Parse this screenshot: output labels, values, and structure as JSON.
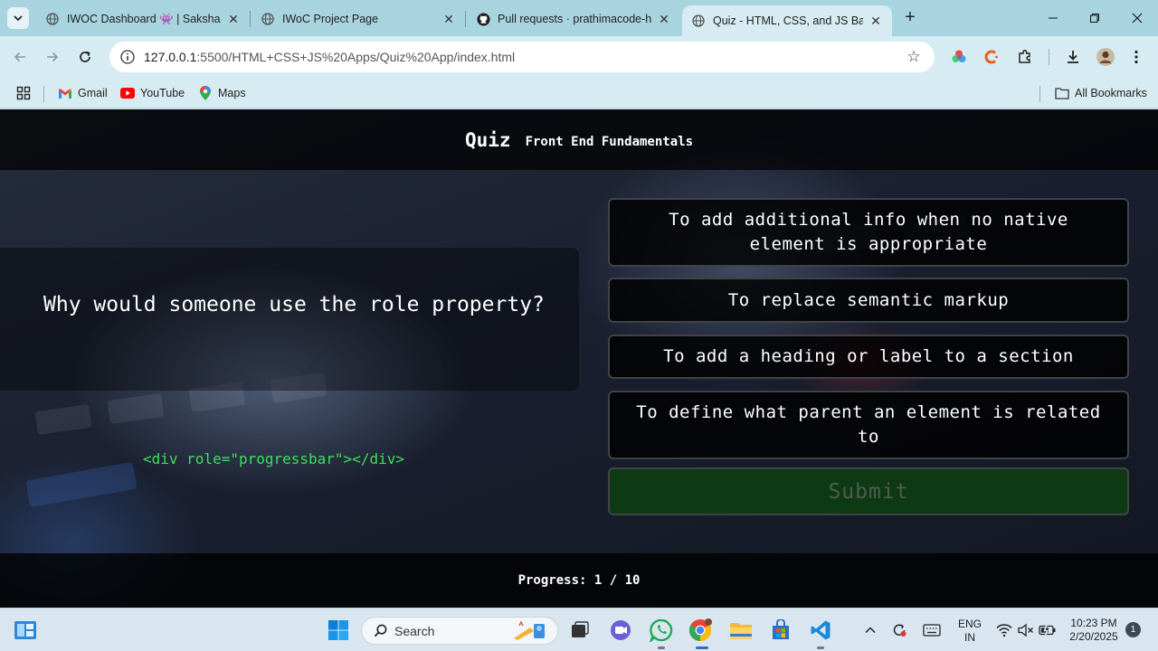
{
  "browser": {
    "tabs": [
      {
        "title": "IWOC Dashboard 👾 | Saksham",
        "icon": "globe-icon"
      },
      {
        "title": "IWoC Project Page",
        "icon": "globe-icon"
      },
      {
        "title": "Pull requests · prathimacode-hub",
        "icon": "github-icon"
      },
      {
        "title": "Quiz - HTML, CSS, and JS Basics",
        "icon": "globe-icon",
        "active": true
      }
    ],
    "url_host": "127.0.0.1",
    "url_path": ":5500/HTML+CSS+JS%20Apps/Quiz%20App/index.html",
    "bookmarks": [
      {
        "label": "Gmail",
        "icon": "gmail-icon"
      },
      {
        "label": "YouTube",
        "icon": "youtube-icon"
      },
      {
        "label": "Maps",
        "icon": "maps-icon"
      }
    ],
    "all_bookmarks_label": "All Bookmarks"
  },
  "quiz": {
    "title": "Quiz",
    "subtitle": "Front End Fundamentals",
    "question": "Why would someone use the role property?",
    "code_sample": "<div role=\"progressbar\"></div>",
    "answers": [
      "To add additional info when no native element is appropriate",
      "To replace semantic markup",
      "To add a heading or label to a section",
      "To define what parent an element is related to"
    ],
    "submit_label": "Submit",
    "progress_text": "Progress: 1 / 10"
  },
  "taskbar": {
    "search_placeholder": "Search",
    "language_line1": "ENG",
    "language_line2": "IN",
    "time": "10:23 PM",
    "date": "2/20/2025",
    "notification_count": "1"
  },
  "colors": {
    "code_green": "#3ce05a",
    "submit_bg": "#0d3a12",
    "tab_strip": "#a8d4e0",
    "toolbar": "#d7ecf2"
  }
}
